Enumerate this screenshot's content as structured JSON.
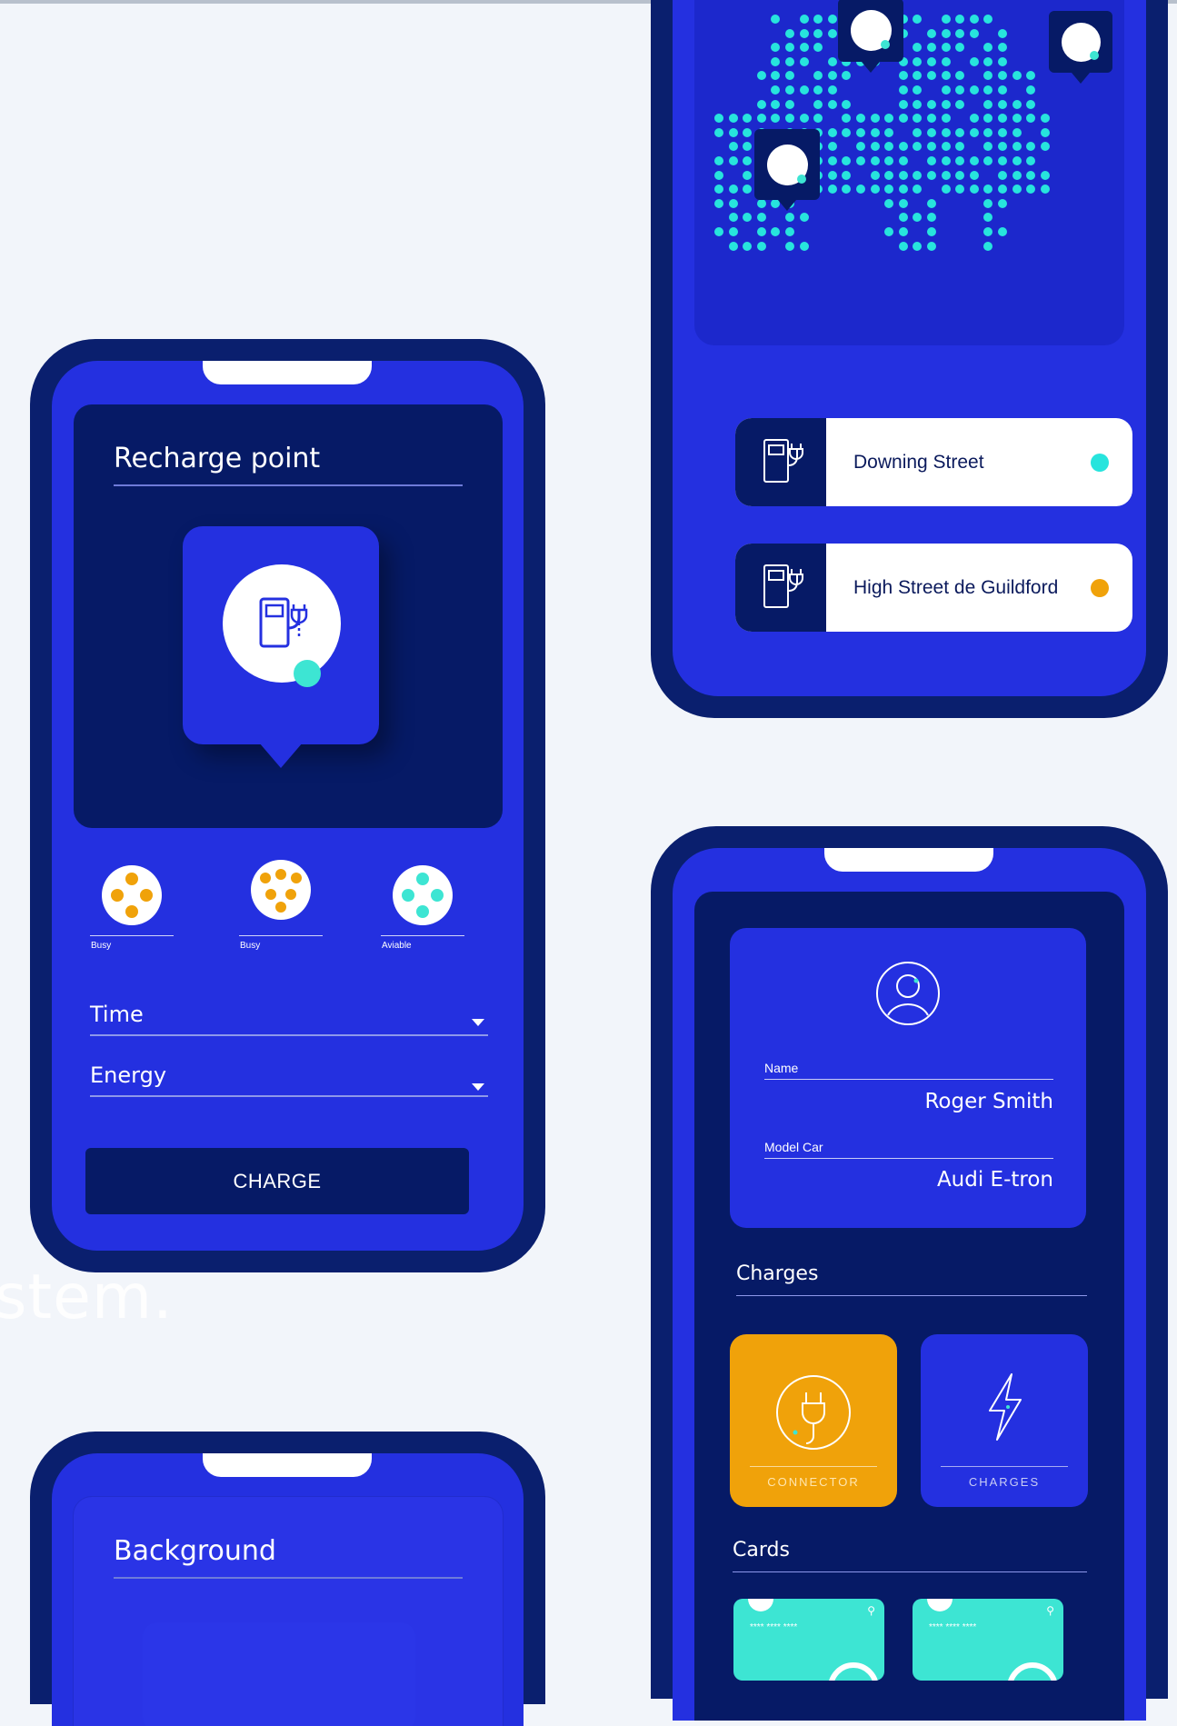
{
  "recharge": {
    "title": "Recharge point",
    "connectors": [
      {
        "label": "Busy",
        "color": "#f0a20a"
      },
      {
        "label": "Busy",
        "color": "#f0a20a"
      },
      {
        "label": "Aviable",
        "color": "#3de5d3"
      }
    ],
    "fields": [
      {
        "label": "Time"
      },
      {
        "label": "Energy"
      }
    ],
    "button": "CHARGE"
  },
  "background_text": "stem.",
  "map": {
    "locations": [
      {
        "name": "Downing Street",
        "status_color": "#27e4dd"
      },
      {
        "name": "High Street de Guildford",
        "status_color": "#f0a20a"
      }
    ]
  },
  "background_screen": {
    "title": "Background"
  },
  "profile": {
    "name_label": "Name",
    "name": "Roger Smith",
    "car_label": "Model Car",
    "car": "Audi E-tron",
    "charges_heading": "Charges",
    "tiles": [
      {
        "label": "CONNECTOR",
        "icon": "plug-icon",
        "color": "#f0a20a"
      },
      {
        "label": "CHARGES",
        "icon": "lightning-icon",
        "color": "#2430e0"
      }
    ],
    "cards_heading": "Cards",
    "cards": [
      {
        "number": "**** **** ****"
      },
      {
        "number": "**** **** ****"
      }
    ]
  },
  "colors": {
    "navy": "#0a1f6e",
    "blue": "#2430e0",
    "orange": "#f0a20a",
    "teal": "#3de5d3"
  }
}
